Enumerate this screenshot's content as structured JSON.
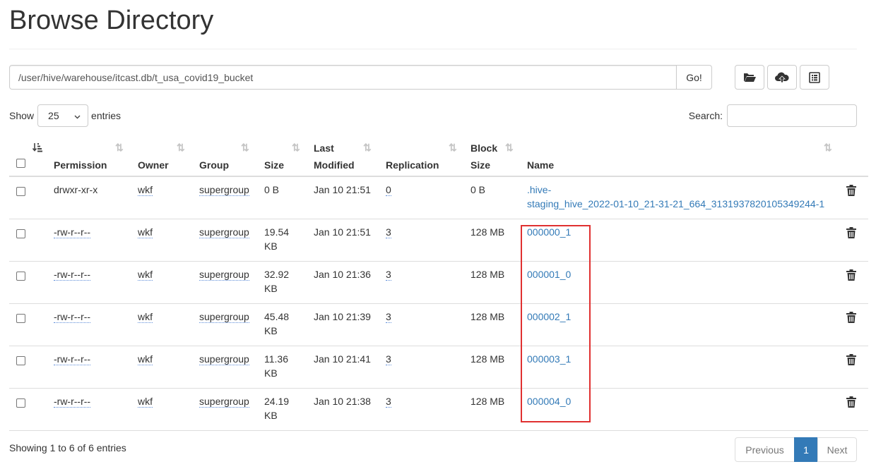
{
  "page": {
    "title": "Browse Directory"
  },
  "path_bar": {
    "value": "/user/hive/warehouse/itcast.db/t_usa_covid19_bucket",
    "go_label": "Go!"
  },
  "toolbar": {
    "icons": [
      "folder-open-icon",
      "cloud-upload-icon",
      "list-alt-icon"
    ]
  },
  "length": {
    "show_label": "Show",
    "value": "25",
    "entries_label": "entries"
  },
  "search": {
    "label": "Search:",
    "value": ""
  },
  "table": {
    "columns": {
      "permission": "Permission",
      "owner": "Owner",
      "group": "Group",
      "size": "Size",
      "last_modified_1": "Last",
      "last_modified_2": "Modified",
      "replication": "Replication",
      "block_size_1": "Block",
      "block_size_2": "Size",
      "name": "Name"
    },
    "rows": [
      {
        "permission": "drwxr-xr-x",
        "owner": "wkf",
        "group": "supergroup",
        "size_1": "0 B",
        "size_2": "",
        "modified": "Jan 10 21:51",
        "replication": "0",
        "block_size": "0 B",
        "name_1": ".hive-",
        "name_2": "staging_hive_2022-01-10_21-31-21_664_3131937820105349244-1"
      },
      {
        "permission": "-rw-r--r--",
        "owner": "wkf",
        "group": "supergroup",
        "size_1": "19.54",
        "size_2": "KB",
        "modified": "Jan 10 21:51",
        "replication": "3",
        "block_size": "128 MB",
        "name_1": "000000_1",
        "name_2": ""
      },
      {
        "permission": "-rw-r--r--",
        "owner": "wkf",
        "group": "supergroup",
        "size_1": "32.92",
        "size_2": "KB",
        "modified": "Jan 10 21:36",
        "replication": "3",
        "block_size": "128 MB",
        "name_1": "000001_0",
        "name_2": ""
      },
      {
        "permission": "-rw-r--r--",
        "owner": "wkf",
        "group": "supergroup",
        "size_1": "45.48",
        "size_2": "KB",
        "modified": "Jan 10 21:39",
        "replication": "3",
        "block_size": "128 MB",
        "name_1": "000002_1",
        "name_2": ""
      },
      {
        "permission": "-rw-r--r--",
        "owner": "wkf",
        "group": "supergroup",
        "size_1": "11.36",
        "size_2": "KB",
        "modified": "Jan 10 21:41",
        "replication": "3",
        "block_size": "128 MB",
        "name_1": "000003_1",
        "name_2": ""
      },
      {
        "permission": "-rw-r--r--",
        "owner": "wkf",
        "group": "supergroup",
        "size_1": "24.19",
        "size_2": "KB",
        "modified": "Jan 10 21:38",
        "replication": "3",
        "block_size": "128 MB",
        "name_1": "000004_0",
        "name_2": ""
      }
    ]
  },
  "footer": {
    "info": "Showing 1 to 6 of 6 entries",
    "previous": "Previous",
    "page": "1",
    "next": "Next"
  },
  "colors": {
    "link": "#337ab7",
    "highlight": "#e03030",
    "active_page": "#337ab7"
  }
}
